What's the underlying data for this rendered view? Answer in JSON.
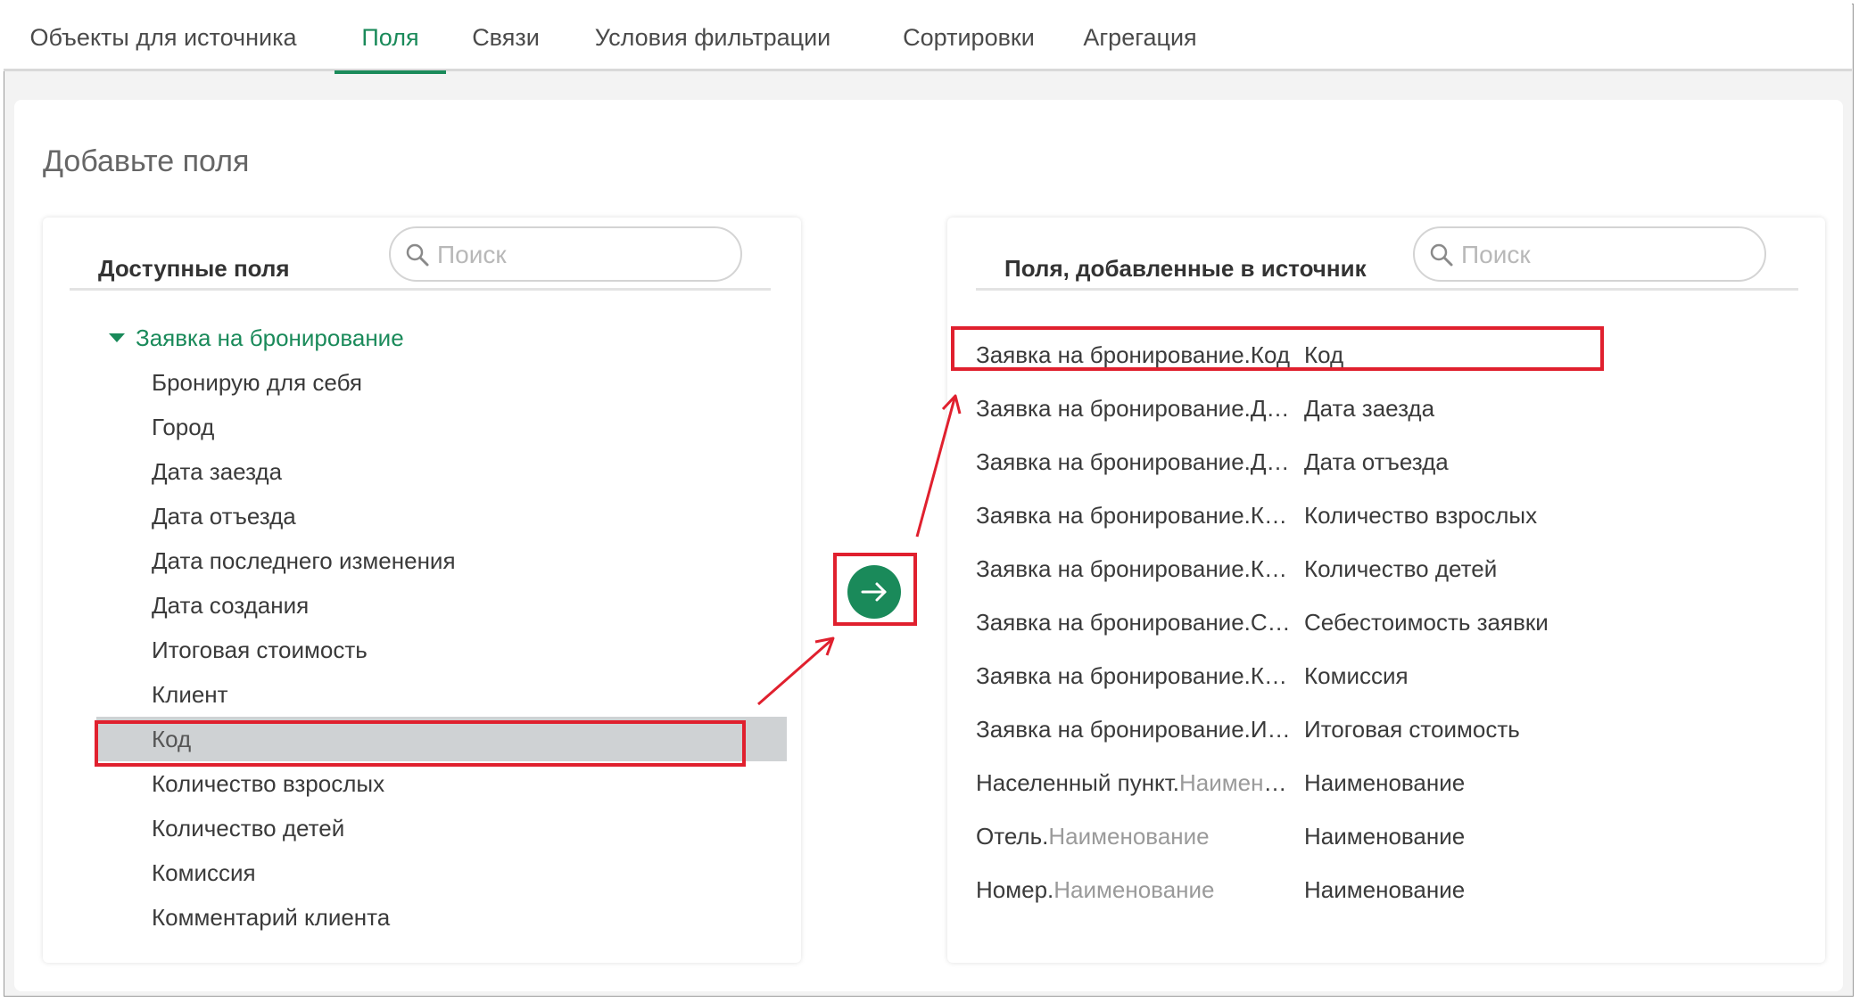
{
  "tabs": [
    {
      "label": "Объекты для источника",
      "active": false
    },
    {
      "label": "Поля",
      "active": true
    },
    {
      "label": "Связи",
      "active": false
    },
    {
      "label": "Условия фильтрации",
      "active": false
    },
    {
      "label": "Сортировки",
      "active": false
    },
    {
      "label": "Агрегация",
      "active": false
    }
  ],
  "heading": "Добавьте поля",
  "available": {
    "title": "Доступные поля",
    "search_placeholder": "Поиск",
    "group": "Заявка на бронирование",
    "items": [
      "Бронирую для себя",
      "Город",
      "Дата заезда",
      "Дата отъезда",
      "Дата последнего изменения",
      "Дата создания",
      "Итоговая стоимость",
      "Клиент",
      "Код",
      "Количество взрослых",
      "Количество детей",
      "Комиссия",
      "Комментарий клиента"
    ],
    "selected_item": "Код"
  },
  "added": {
    "title": "Поля, добавленные в источник",
    "search_placeholder": "Поиск",
    "items": [
      {
        "object": "Заявка на бронирование.",
        "path_rest": "Код",
        "field": "Код"
      },
      {
        "object": "Заявка на бронирование.",
        "path_rest": "Дата заезда",
        "field": "Дата заезда"
      },
      {
        "object": "Заявка на бронирование.",
        "path_rest": "Дата отъезда",
        "field": "Дата отъезда"
      },
      {
        "object": "Заявка на бронирование.",
        "path_rest": "Количество взрослых",
        "field": "Количество взрослых"
      },
      {
        "object": "Заявка на бронирование.",
        "path_rest": "Количество детей",
        "field": "Количество детей"
      },
      {
        "object": "Заявка на бронирование.",
        "path_rest": "Себестоимость заявки",
        "field": "Себестоимость заявки"
      },
      {
        "object": "Заявка на бронирование.",
        "path_rest": "Комиссия",
        "field": "Комиссия"
      },
      {
        "object": "Заявка на бронирование.",
        "path_rest": "Итоговая стоимость",
        "field": "Итоговая стоимость"
      },
      {
        "object": "Населенный пункт.",
        "path_rest": "Наименование",
        "field": "Наименование"
      },
      {
        "object": "Отель.",
        "path_rest": "Наименование",
        "field": "Наименование"
      },
      {
        "object": "Номер.",
        "path_rest": "Наименование",
        "field": "Наименование"
      }
    ]
  },
  "colors": {
    "accent": "#1a8a5a",
    "highlight": "#e0202e",
    "selected_row": "#cfd2d4"
  }
}
